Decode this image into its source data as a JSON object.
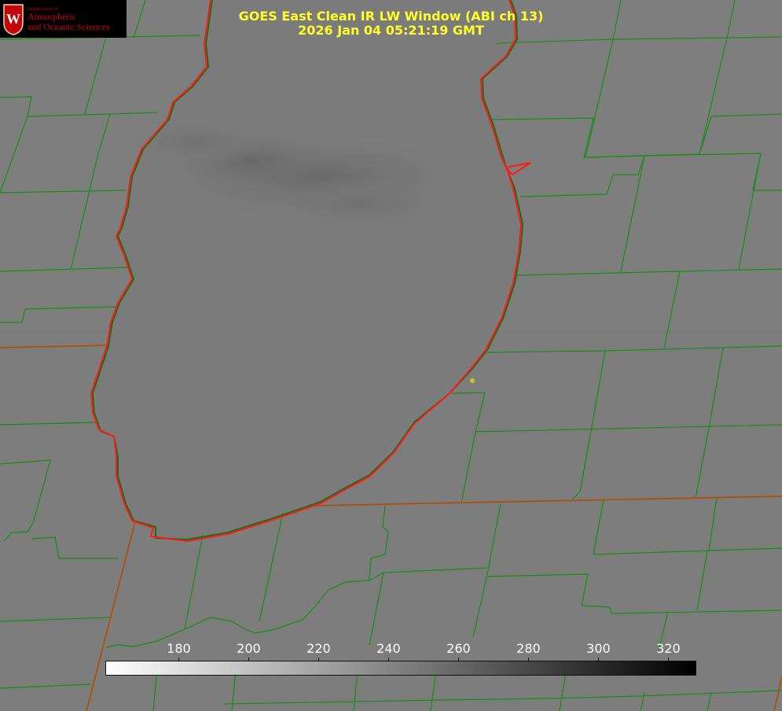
{
  "header": {
    "title_line1": "GOES East Clean IR LW Window (ABI ch 13)",
    "title_line2": "2026 Jan 04 05:21:19 GMT"
  },
  "logo": {
    "department": "Department of",
    "line1": "Atmospheric",
    "line2": "and Oceanic Sciences",
    "seal_letter": "W"
  },
  "colorbar": {
    "range": [
      159,
      328
    ],
    "ticks": [
      "180",
      "200",
      "220",
      "240",
      "260",
      "280",
      "300",
      "320"
    ],
    "colormap": "white-to-black (inverted grayscale)",
    "units": ""
  },
  "map": {
    "feature": "Lake Michigan",
    "colors": {
      "shoreline": "#ff1a1a",
      "county_lines": "#1a8c1a",
      "state_lines": "#b34a00",
      "background": "#7d7d7d",
      "marker": "#d9c21a"
    }
  }
}
